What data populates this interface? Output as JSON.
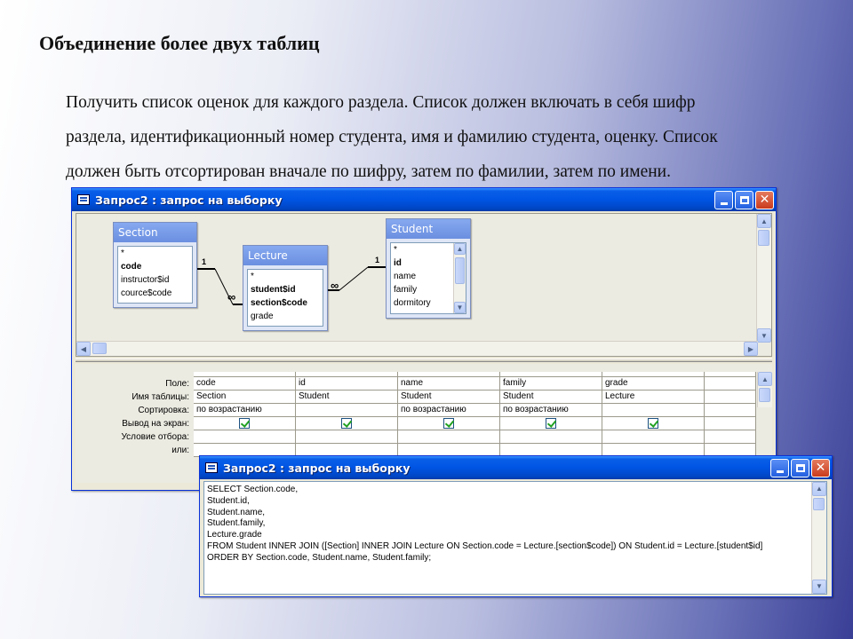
{
  "slide": {
    "title": "Объединение более двух таблиц",
    "lines": [
      "Получить список оценок для каждого раздела. Список должен включать в себя шифр",
      "раздела, идентификационный номер студента, имя и фамилию студента, оценку. Список",
      "должен быть отсортирован вначале по шифру, затем по фамилии, затем по имени."
    ]
  },
  "design_window": {
    "title": "Запрос2 : запрос на выборку",
    "tables": [
      {
        "name": "Section",
        "fields": [
          "*",
          "code",
          "instructor$id",
          "cource$code"
        ],
        "bold": [
          false,
          true,
          false,
          false
        ]
      },
      {
        "name": "Lecture",
        "fields": [
          "*",
          "student$id",
          "section$code",
          "grade"
        ],
        "bold": [
          false,
          true,
          true,
          false
        ]
      },
      {
        "name": "Student",
        "fields": [
          "*",
          "id",
          "name",
          "family",
          "dormitory"
        ],
        "bold": [
          false,
          true,
          false,
          false,
          false
        ]
      }
    ],
    "relations": [
      {
        "one": "1",
        "many": "∞"
      },
      {
        "one": "1",
        "many": "∞"
      }
    ],
    "grid": {
      "row_labels": [
        "Поле:",
        "Имя таблицы:",
        "Сортировка:",
        "Вывод на экран:",
        "Условие отбора:",
        "или:"
      ],
      "columns": [
        {
          "field": "code",
          "table": "Section",
          "sort": "по возрастанию",
          "show": true
        },
        {
          "field": "id",
          "table": "Student",
          "sort": "",
          "show": true
        },
        {
          "field": "name",
          "table": "Student",
          "sort": "по возрастанию",
          "show": true
        },
        {
          "field": "family",
          "table": "Student",
          "sort": "по возрастанию",
          "show": true
        },
        {
          "field": "grade",
          "table": "Lecture",
          "sort": "",
          "show": true
        }
      ]
    }
  },
  "sql_window": {
    "title": "Запрос2 : запрос на выборку",
    "lines": [
      "SELECT Section.code,",
      "Student.id,",
      "Student.name,",
      "Student.family,",
      "Lecture.grade",
      "FROM Student INNER JOIN ([Section] INNER JOIN Lecture ON Section.code = Lecture.[section$code]) ON Student.id = Lecture.[student$id]",
      "ORDER BY Section.code, Student.name, Student.family;"
    ]
  },
  "colors": {
    "titlebar": "#0054e3",
    "close_button": "#c93b1b",
    "table_header": "#6b8fe0"
  }
}
